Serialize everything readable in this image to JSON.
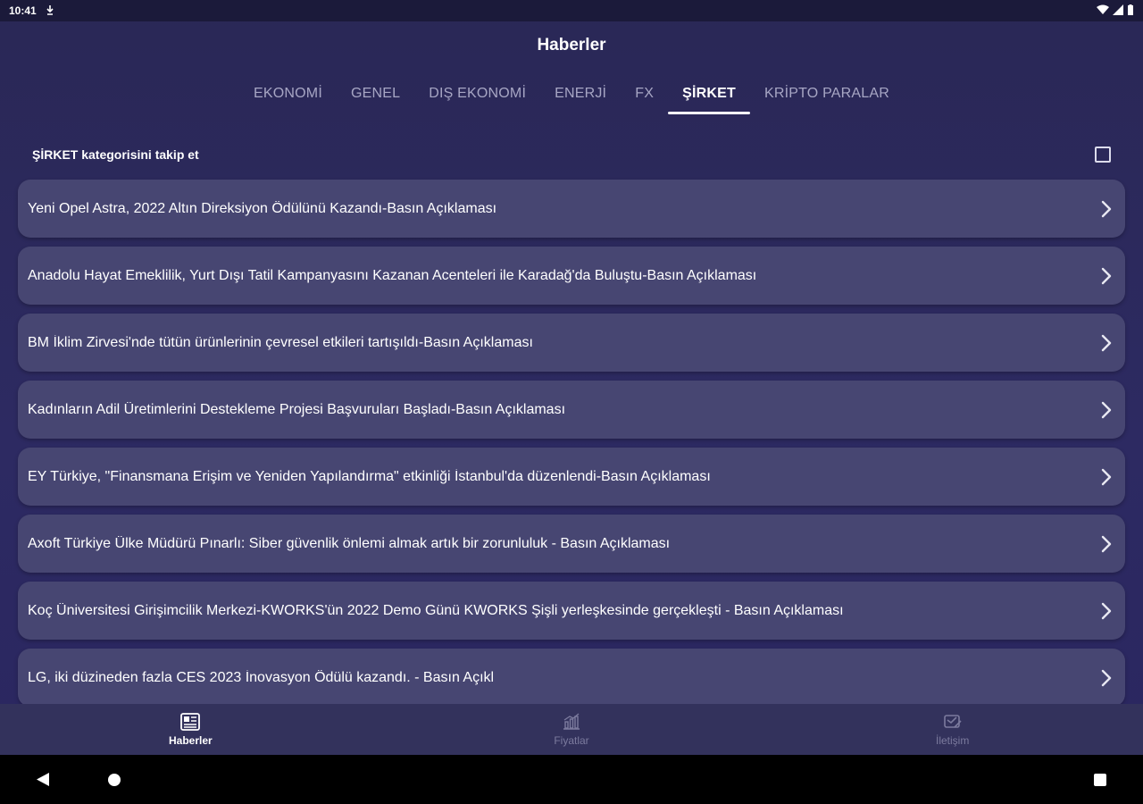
{
  "status_bar": {
    "time": "10:41"
  },
  "app": {
    "title": "Haberler"
  },
  "tabs": [
    {
      "label": "EKONOMİ"
    },
    {
      "label": "GENEL"
    },
    {
      "label": "DIŞ EKONOMİ"
    },
    {
      "label": "ENERJİ"
    },
    {
      "label": "FX"
    },
    {
      "label": "ŞİRKET",
      "active": true
    },
    {
      "label": "KRİPTO PARALAR"
    }
  ],
  "follow": {
    "label": "ŞİRKET kategorisini takip et"
  },
  "news": [
    {
      "title": "Yeni Opel Astra, 2022 Altın Direksiyon Ödülünü Kazandı-Basın Açıklaması"
    },
    {
      "title": "Anadolu Hayat Emeklilik, Yurt Dışı Tatil Kampanyasını Kazanan Acenteleri ile Karadağ'da Buluştu-Basın Açıklaması"
    },
    {
      "title": "BM İklim Zirvesi'nde tütün ürünlerinin çevresel etkileri tartışıldı-Basın Açıklaması"
    },
    {
      "title": "Kadınların Adil Üretimlerini Destekleme Projesi Başvuruları Başladı-Basın Açıklaması"
    },
    {
      "title": "EY Türkiye, \"Finansmana Erişim ve Yeniden Yapılandırma\" etkinliği İstanbul'da düzenlendi-Basın Açıklaması"
    },
    {
      "title": "Axoft Türkiye Ülke Müdürü Pınarlı: Siber güvenlik önlemi almak artık bir zorunluluk - Basın Açıklaması"
    },
    {
      "title": "Koç Üniversitesi Girişimcilik Merkezi-KWORKS'ün 2022 Demo Günü KWORKS Şişli yerleşkesinde gerçekleşti - Basın Açıklaması"
    },
    {
      "title": "LG,  iki düzineden fazla CES 2023 İnovasyon Ödülü kazandı.   - Basın Açıkl"
    }
  ],
  "bottom_nav": [
    {
      "label": "Haberler",
      "icon": "newspaper-icon",
      "active": true
    },
    {
      "label": "Fiyatlar",
      "icon": "chart-icon"
    },
    {
      "label": "İletişim",
      "icon": "contact-icon"
    }
  ]
}
